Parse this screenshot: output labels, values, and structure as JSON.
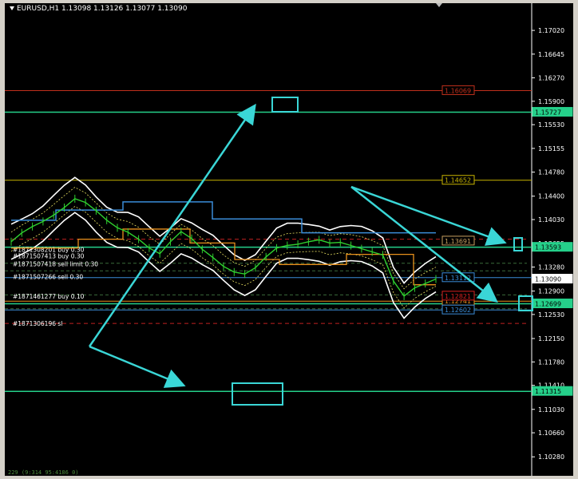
{
  "header": {
    "symbol_info": "EURUSD,H1  1.13098 1.13126 1.13077 1.13090"
  },
  "footer": {
    "note": "229 (9:314 95:4186 0)"
  },
  "chart_data": {
    "type": "line",
    "instrument": "EURUSD",
    "timeframe": "H1",
    "ohlc_last": {
      "open": 1.13098,
      "high": 1.13126,
      "low": 1.13077,
      "close": 1.1309
    },
    "ylim": [
      1.0998,
      1.1745
    ],
    "y_ticks": [
      "1.17020",
      "1.16645",
      "1.16270",
      "1.15900",
      "1.15530",
      "1.15155",
      "1.14780",
      "1.14400",
      "1.14030",
      "1.13655",
      "1.13280",
      "1.12900",
      "1.12530",
      "1.12150",
      "1.11780",
      "1.11410",
      "1.11030",
      "1.10660",
      "1.10280"
    ],
    "price_levels": [
      {
        "value": 1.16069,
        "label": "1.16069",
        "color": "#c0301c",
        "style": "solid"
      },
      {
        "value": 1.15727,
        "label": "1.15727",
        "color": "#25d08a",
        "style": "solid"
      },
      {
        "value": 1.14652,
        "label": "1.14652",
        "color": "#c8b400",
        "style": "solid"
      },
      {
        "value": 1.13593,
        "label": "1.13593",
        "color": "#25d08a",
        "style": "solid"
      },
      {
        "value": 1.13112,
        "label": "1.13112",
        "color": "#3a8cd8",
        "style": "solid"
      },
      {
        "value": 1.12699,
        "label": "1.12699",
        "color": "#25d08a",
        "style": "solid"
      },
      {
        "value": 1.12741,
        "label": "1.12741",
        "color": "#e8901c",
        "style": "solid"
      },
      {
        "value": 1.12602,
        "label": "1.12602",
        "color": "#3a8cd8",
        "style": "solid"
      },
      {
        "value": 1.11315,
        "label": "1.11315",
        "color": "#25d08a",
        "style": "solid"
      }
    ],
    "minor_labels": [
      {
        "value": 1.13691,
        "label": "1.13691",
        "color": "#c8a060"
      },
      {
        "value": 1.12821,
        "label": "1.12821",
        "color": "#d82020"
      }
    ],
    "current_price": {
      "value": 1.1309,
      "label": "1.13090"
    },
    "order_labels": [
      {
        "value": 1.13555,
        "text": "#1871308201 buy 0.30"
      },
      {
        "value": 1.13455,
        "text": "#1871507413 buy 0.30"
      },
      {
        "value": 1.13327,
        "text": "#1871507418 sell limit 0.30"
      },
      {
        "value": 1.13127,
        "text": "#1871507266 sell 0.30"
      },
      {
        "value": 1.12816,
        "text": "#1871461277 buy 0.10"
      },
      {
        "value": 1.12388,
        "text": "#1871306196 sl"
      }
    ],
    "series": [
      {
        "name": "",
        "color": "#2fd02f",
        "x": [
          0,
          1,
          2,
          3,
          4,
          5,
          6,
          7,
          8,
          9,
          10,
          11,
          12,
          13,
          14,
          15,
          16,
          17,
          18,
          19,
          20,
          21,
          22,
          23,
          24,
          25,
          26,
          27,
          28,
          29,
          30,
          31,
          32,
          33,
          34,
          35,
          36,
          37,
          38,
          39,
          40
        ],
        "values": [
          1.1368,
          1.1382,
          1.1392,
          1.14,
          1.141,
          1.1422,
          1.1436,
          1.143,
          1.1417,
          1.1402,
          1.139,
          1.1383,
          1.1372,
          1.1358,
          1.1349,
          1.1368,
          1.1384,
          1.1373,
          1.1356,
          1.1343,
          1.1329,
          1.132,
          1.1317,
          1.1327,
          1.1344,
          1.1358,
          1.1362,
          1.1364,
          1.1368,
          1.1371,
          1.1366,
          1.1367,
          1.1362,
          1.1357,
          1.1352,
          1.1347,
          1.1306,
          1.1282,
          1.1295,
          1.1302,
          1.1309
        ]
      }
    ]
  }
}
